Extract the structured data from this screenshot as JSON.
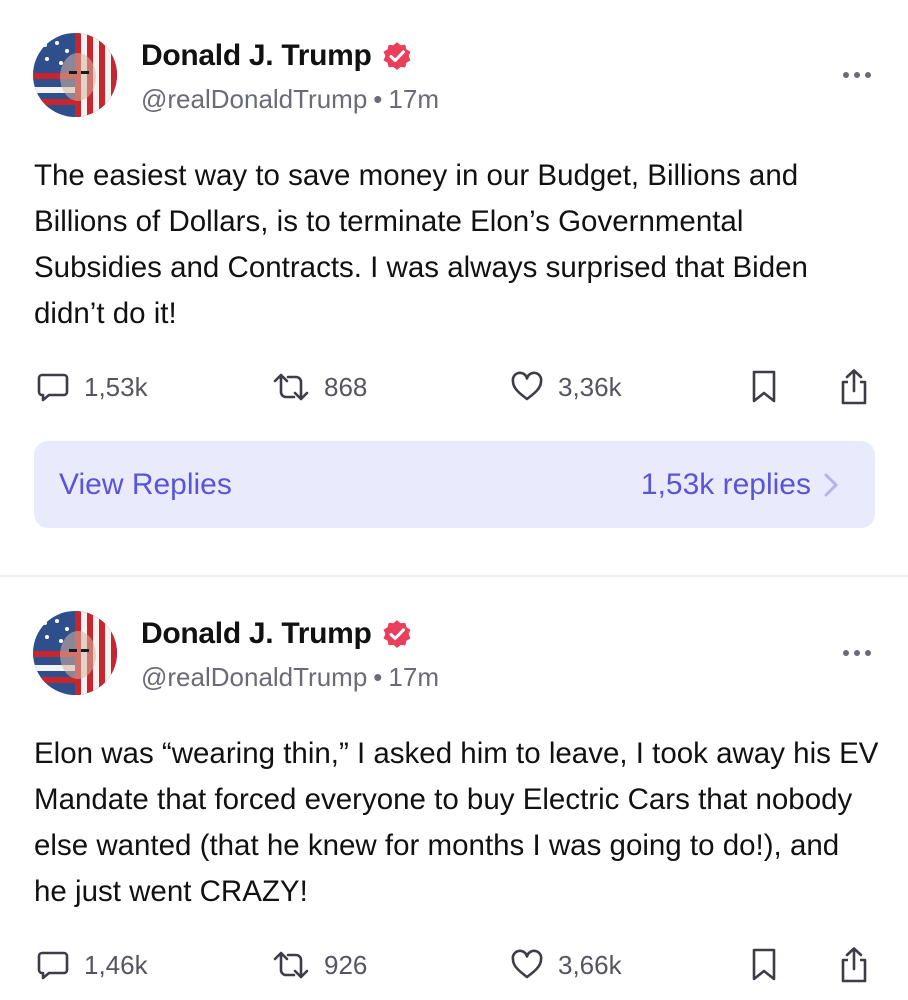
{
  "posts": [
    {
      "author": "Donald J. Trump",
      "handle": "@realDonaldTrump",
      "separator": "•",
      "time": "17m",
      "text": "The easiest way to save money in our Budget, Billions and Billions of Dollars, is to terminate Elon’s Governmental Subsidies and Contracts. I was always surprised that Biden didn’t do it!",
      "replies": "1,53k",
      "reposts": "868",
      "likes": "3,36k",
      "view_replies": {
        "label": "View Replies",
        "count": "1,53k replies"
      }
    },
    {
      "author": "Donald J. Trump",
      "handle": "@realDonaldTrump",
      "separator": "•",
      "time": "17m",
      "text": "Elon was “wearing thin,” I asked him to leave, I took away his EV Mandate that forced everyone to buy Electric Cars that nobody else wanted (that he knew for months I was going to do!), and he just went CRAZY!",
      "replies": "1,46k",
      "reposts": "926",
      "likes": "3,66k"
    }
  ],
  "icons": {
    "verified": "verified-badge-icon",
    "more": "more-dots-icon",
    "reply": "comment-icon",
    "repost": "repost-icon",
    "like": "heart-icon",
    "bookmark": "bookmark-icon",
    "share": "share-icon",
    "chevron": "chevron-right-icon"
  },
  "colors": {
    "verified": "#ea3f5c",
    "accent": "#5b54d6",
    "replies_bg": "#e9eafc",
    "muted": "#6b6b78"
  }
}
